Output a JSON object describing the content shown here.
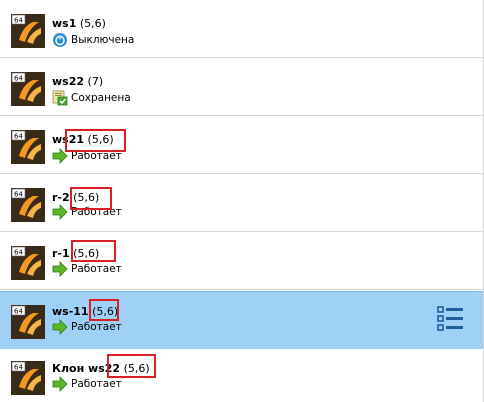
{
  "vms": [
    {
      "name": "ws1",
      "version": "(5,6)",
      "state": "Выключена",
      "state_icon": "power-off-icon",
      "os_badge": "64"
    },
    {
      "name": "ws22",
      "version": "(7)",
      "state": "Сохранена",
      "state_icon": "saved-state-icon",
      "os_badge": "64"
    },
    {
      "name": "ws21",
      "version": "(5,6)",
      "state": "Работает",
      "state_icon": "running-arrow-icon",
      "os_badge": "64"
    },
    {
      "name": "r-2",
      "version": "(5,6)",
      "state": "Работает",
      "state_icon": "running-arrow-icon",
      "os_badge": "64"
    },
    {
      "name": "r-1",
      "version": "(5,6)",
      "state": "Работает",
      "state_icon": "running-arrow-icon",
      "os_badge": "64"
    },
    {
      "name": "ws-11",
      "version": "(5,6)",
      "state": "Работает",
      "state_icon": "running-arrow-icon",
      "os_badge": "64",
      "selected": true
    },
    {
      "name": "Клон ws22",
      "version": "(5,6)",
      "state": "Работает",
      "state_icon": "running-arrow-icon",
      "os_badge": "64"
    }
  ],
  "colors": {
    "selected_row": "#9fd0f6",
    "highlight_box": "#d91e24",
    "running_arrow": "#5cb82a",
    "power_icon": "#2a8fd6"
  }
}
